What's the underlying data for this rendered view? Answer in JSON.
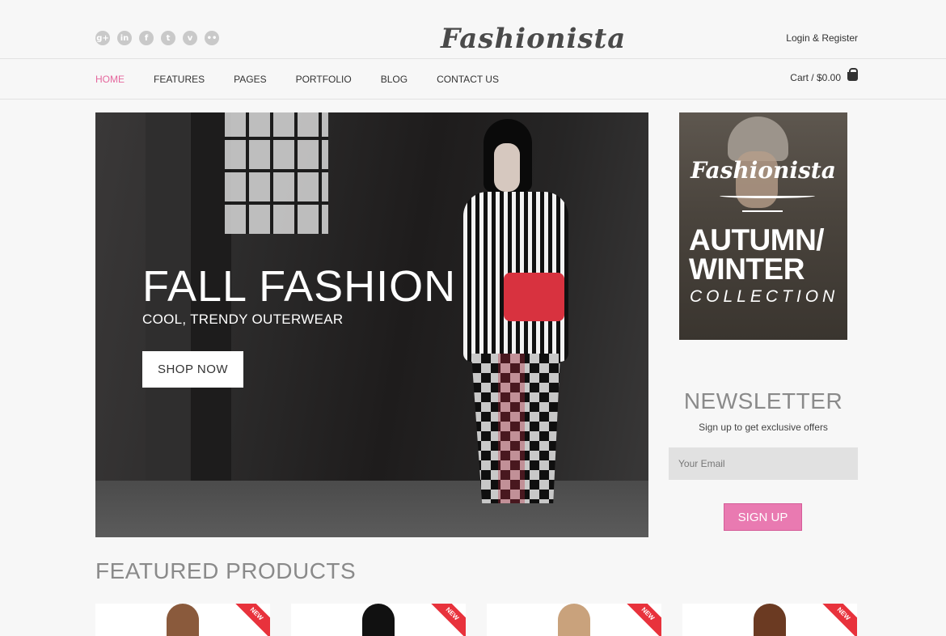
{
  "header": {
    "logo": "Fashionista",
    "login": "Login & Register",
    "social": [
      {
        "icon": "google-plus-icon",
        "glyph": "g+"
      },
      {
        "icon": "linkedin-icon",
        "glyph": "in"
      },
      {
        "icon": "facebook-icon",
        "glyph": "f"
      },
      {
        "icon": "twitter-icon",
        "glyph": "t"
      },
      {
        "icon": "vimeo-icon",
        "glyph": "v"
      },
      {
        "icon": "flickr-icon",
        "glyph": "••"
      }
    ]
  },
  "nav": {
    "items": [
      "HOME",
      "FEATURES",
      "PAGES",
      "PORTFOLIO",
      "BLOG",
      "CONTACT US"
    ],
    "active": "HOME",
    "cart": "Cart / $0.00",
    "cart_icon": "basket-icon"
  },
  "hero": {
    "title": "FALL FASHION",
    "subtitle": "COOL, TRENDY OUTERWEAR",
    "button": "SHOP NOW"
  },
  "promo": {
    "logo": "Fashionista",
    "headline_line1": "AUTUMN/",
    "headline_line2": "WINTER",
    "collection": "COLLECTION"
  },
  "newsletter": {
    "title": "NEWSLETTER",
    "subtitle": "Sign up to get exclusive offers",
    "placeholder": "Your Email",
    "button": "SIGN UP"
  },
  "featured": {
    "title": "FEATURED PRODUCTS",
    "products": [
      {
        "badge": "NEW"
      },
      {
        "badge": "NEW"
      },
      {
        "badge": "NEW"
      },
      {
        "badge": "NEW"
      }
    ]
  },
  "colors": {
    "accent": "#e5679d",
    "button_pink": "#e97ab1",
    "badge_red": "#e8323c"
  }
}
